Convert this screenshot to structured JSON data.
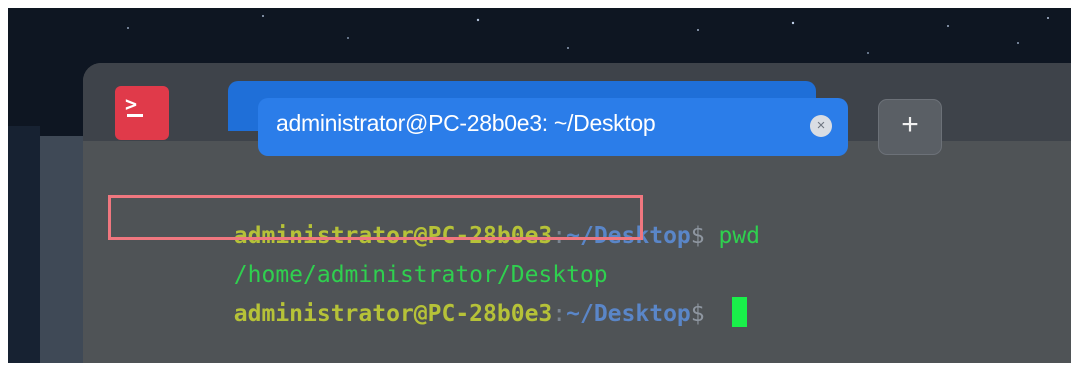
{
  "tab": {
    "title": "administrator@PC-28b0e3: ~/Desktop",
    "close_symbol": "×"
  },
  "new_tab": {
    "label": "+"
  },
  "app_icon": {
    "name": "terminal-icon",
    "glyph": ">"
  },
  "terminal": {
    "lines": [
      {
        "user": "administrator@PC-28b0e3",
        "sep": ":",
        "path": "~/Desktop",
        "prompt": "$ ",
        "command": "pwd"
      },
      {
        "output": "/home/administrator/Desktop"
      },
      {
        "user": "administrator@PC-28b0e3",
        "sep": ":",
        "path": "~/Desktop",
        "prompt": "$ ",
        "command": ""
      }
    ]
  },
  "colors": {
    "tab_active": "#2b7de9",
    "app_icon": "#e03a4a",
    "user_host": "#b6c238",
    "path": "#5a86c8",
    "output": "#2fd04f",
    "cursor": "#19f04a",
    "highlight_box": "#f0777f"
  }
}
